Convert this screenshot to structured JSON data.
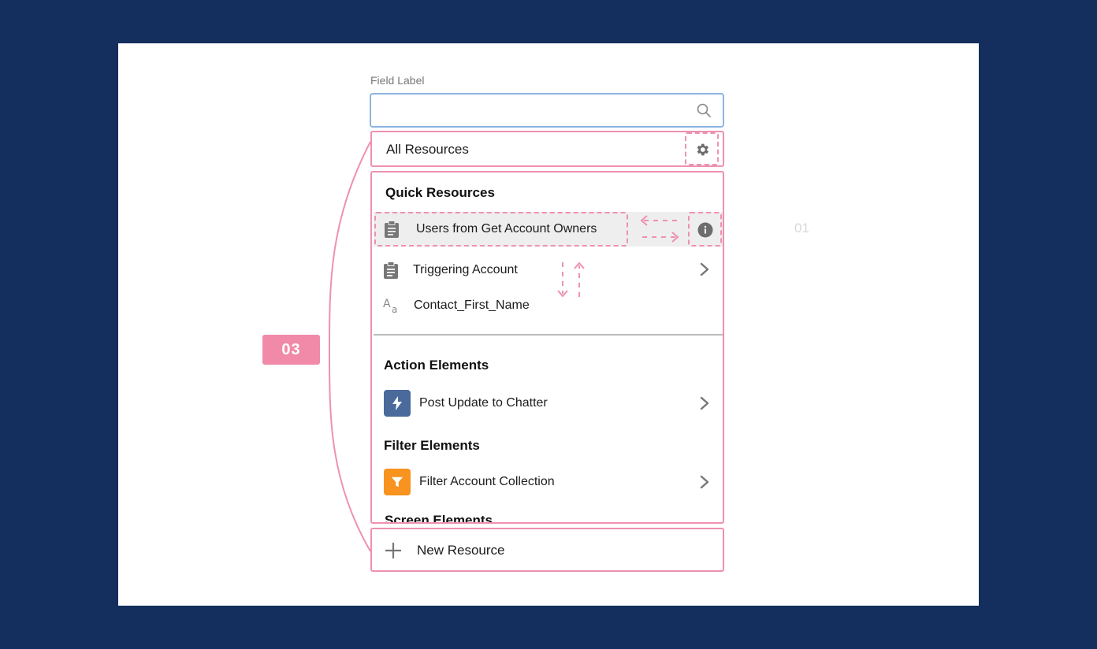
{
  "field_label": "Field Label",
  "search": {
    "placeholder": "",
    "icon": "search-icon"
  },
  "filter": {
    "label": "All Resources",
    "icon": "gear-icon"
  },
  "sections": {
    "quick": {
      "title": "Quick Resources",
      "items": [
        {
          "label": "Users from Get Account Owners",
          "icon": "clipboard-icon",
          "trailing": "info-icon",
          "highlighted": true
        },
        {
          "label": "Triggering Account",
          "icon": "clipboard-icon",
          "trailing": "chevron-right-icon"
        },
        {
          "label": "Contact_First_Name",
          "icon": "text-variable-icon"
        }
      ]
    },
    "action": {
      "title": "Action Elements",
      "items": [
        {
          "label": "Post Update to Chatter",
          "icon": "lightning-icon",
          "icon_color": "#4a6a9c",
          "trailing": "chevron-right-icon"
        }
      ]
    },
    "filter": {
      "title": "Filter Elements",
      "items": [
        {
          "label": "Filter Account Collection",
          "icon": "filter-icon",
          "icon_color": "#f7931e",
          "trailing": "chevron-right-icon"
        }
      ]
    },
    "screen": {
      "title": "Screen Elements"
    }
  },
  "footer": {
    "label": "New Resource",
    "icon": "plus-icon"
  },
  "annotations": {
    "badge_03": "03",
    "side_label": "01",
    "accent": "#ee91b1"
  },
  "colors": {
    "background": "#142e5e",
    "canvas": "#ffffff",
    "search_border": "#8cb5e0"
  }
}
